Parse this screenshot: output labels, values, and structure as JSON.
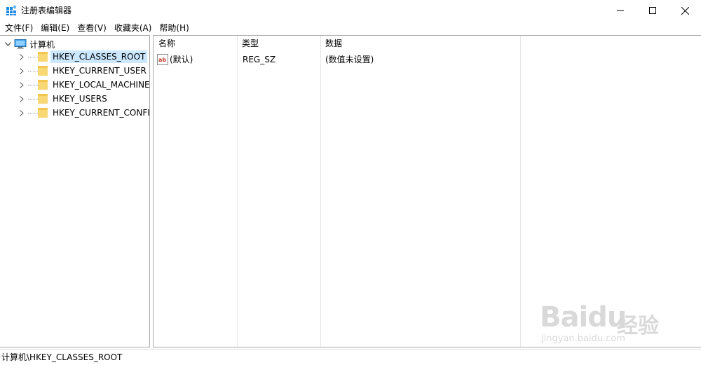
{
  "window": {
    "title": "注册表编辑器",
    "app_icon": "regedit-icon"
  },
  "menu": [
    "文件(F)",
    "编辑(E)",
    "查看(V)",
    "收藏夹(A)",
    "帮助(H)"
  ],
  "tree": {
    "root": "计算机",
    "hives": [
      {
        "label": "HKEY_CLASSES_ROOT",
        "selected": true
      },
      {
        "label": "HKEY_CURRENT_USER",
        "selected": false
      },
      {
        "label": "HKEY_LOCAL_MACHINE",
        "selected": false
      },
      {
        "label": "HKEY_USERS",
        "selected": false
      },
      {
        "label": "HKEY_CURRENT_CONFIG",
        "selected": false
      }
    ]
  },
  "list": {
    "columns": [
      "名称",
      "类型",
      "数据"
    ],
    "rows": [
      {
        "name": "(默认)",
        "type": "REG_SZ",
        "data": "(数值未设置)",
        "icon": "string-value-icon"
      }
    ]
  },
  "status": {
    "path": "计算机\\HKEY_CLASSES_ROOT"
  },
  "watermark": {
    "brand": "Bai",
    "brand2": "du",
    "cn": "经验",
    "url": "jingyan.baidu.com"
  },
  "colors": {
    "selection": "#cce8ff",
    "border": "#a8a8a8",
    "folder": "#f8d775"
  }
}
